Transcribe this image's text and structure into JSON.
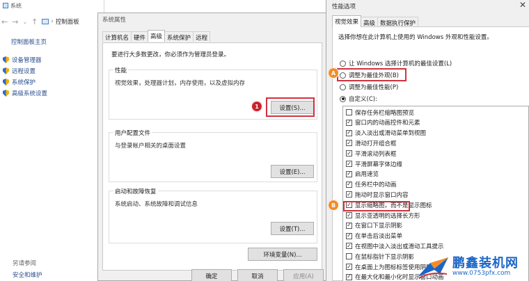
{
  "control_panel": {
    "title": "系统",
    "breadcrumb": "控制面板",
    "home_link": "控制面板主页",
    "links": [
      "设备管理器",
      "远程设置",
      "系统保护",
      "高级系统设置"
    ],
    "see_also": "另请参阅",
    "security": "安全和维护"
  },
  "system_properties": {
    "title": "系统属性",
    "tabs": [
      "计算机名",
      "硬件",
      "高级",
      "系统保护",
      "远程"
    ],
    "active_tab": "高级",
    "admin_note": "要进行大多数更改，你必须作为管理员登录。",
    "performance": {
      "title": "性能",
      "desc": "视觉效果，处理器计划，内存使用，以及虚拟内存",
      "button": "设置(S)..."
    },
    "user_profiles": {
      "title": "用户配置文件",
      "desc": "与登录帐户相关的桌面设置",
      "button": "设置(E)..."
    },
    "startup_recovery": {
      "title": "启动和故障恢复",
      "desc": "系统启动、系统故障和调试信息",
      "button": "设置(T)..."
    },
    "env_button": "环境变量(N)...",
    "ok": "确定",
    "cancel": "取消",
    "apply": "应用(A)",
    "step_badge": "1"
  },
  "performance_options": {
    "title": "性能选项",
    "close": "✕",
    "tabs": [
      "视觉效果",
      "高级",
      "数据执行保护"
    ],
    "active_tab": "视觉效果",
    "prompt": "选择你想在此计算机上使用的 Windows 外观和性能设置。",
    "radios": [
      {
        "label": "让 Windows 选择计算机的最佳设置(L)",
        "selected": false
      },
      {
        "label": "调整为最佳外观(B)",
        "selected": false
      },
      {
        "label": "调整为最佳性能(P)",
        "selected": false
      },
      {
        "label": "自定义(C):",
        "selected": true
      }
    ],
    "badge_a": "A",
    "badge_b": "B",
    "effects": [
      {
        "label": "保存任务栏缩略图预览",
        "checked": false
      },
      {
        "label": "窗口内的动画控件和元素",
        "checked": true
      },
      {
        "label": "淡入淡出或滑动菜单到视图",
        "checked": true
      },
      {
        "label": "滑动打开组合框",
        "checked": true
      },
      {
        "label": "平滑滚动列表框",
        "checked": true
      },
      {
        "label": "平滑屏幕字体边缘",
        "checked": true
      },
      {
        "label": "启用速览",
        "checked": true
      },
      {
        "label": "任务栏中的动画",
        "checked": true
      },
      {
        "label": "拖动时显示窗口内容",
        "checked": true
      },
      {
        "label": "显示缩略图，而不是显示图标",
        "checked": true
      },
      {
        "label": "显示亚透明的选择长方形",
        "checked": true
      },
      {
        "label": "在窗口下显示阴影",
        "checked": true
      },
      {
        "label": "在单击后淡出菜单",
        "checked": true
      },
      {
        "label": "在视图中淡入淡出或滑动工具提示",
        "checked": true
      },
      {
        "label": "在鼠标指针下显示阴影",
        "checked": false
      },
      {
        "label": "在桌面上为图标标签使用阴影",
        "checked": true
      },
      {
        "label": "在最大化和最小化时显示窗口动画",
        "checked": true
      }
    ]
  },
  "watermark": {
    "name": "鹏鑫装机网",
    "url": "www.0753pfx.com"
  }
}
